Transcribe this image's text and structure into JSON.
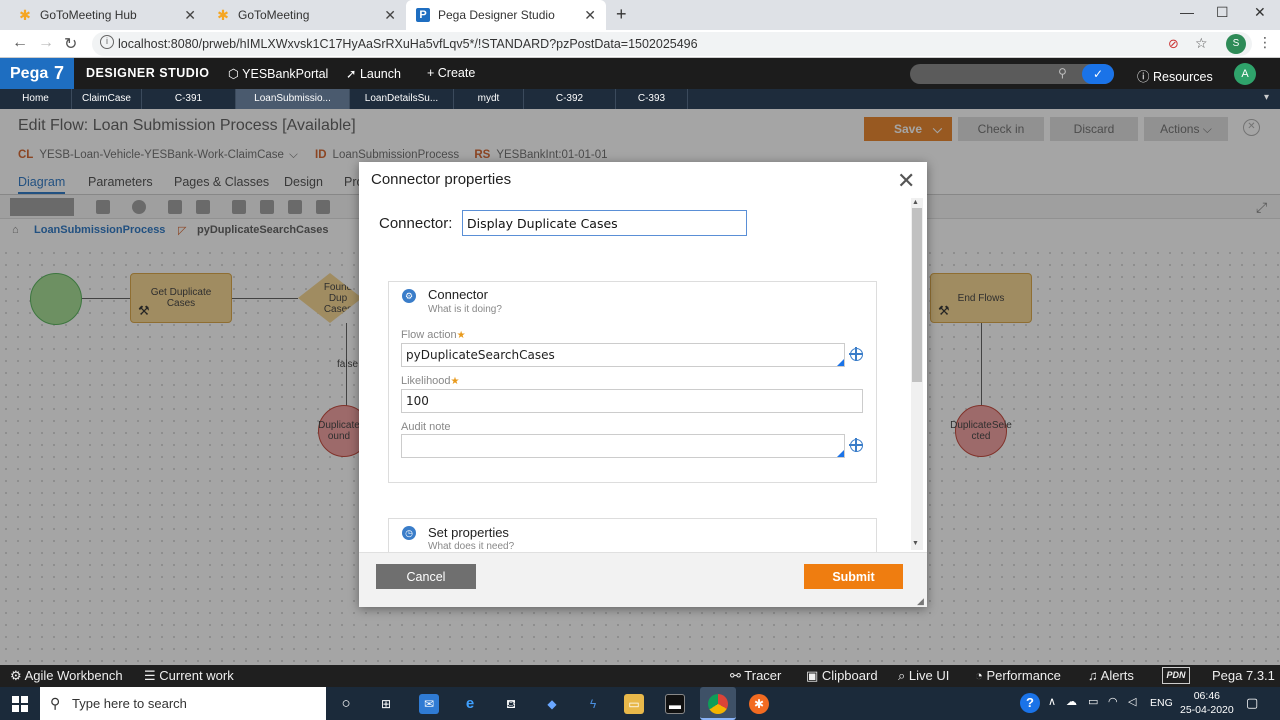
{
  "browser": {
    "tabs": [
      {
        "title": "GoToMeeting Hub"
      },
      {
        "title": "GoToMeeting"
      },
      {
        "title": "Pega Designer Studio"
      }
    ],
    "url": "localhost:8080/prweb/hIMLXWxvsk1C17HyAaSrRXuHa5vfLqv5*/!STANDARD?pzPostData=1502025496",
    "profile_initial": "S"
  },
  "pega_header": {
    "logo": "Pega",
    "version_badge": "7",
    "studio": "DESIGNER STUDIO",
    "app": "YESBankPortal",
    "launch": "Launch",
    "create": "Create",
    "resources": "Resources",
    "user_initial": "A"
  },
  "work_tabs": [
    "Home",
    "ClaimCase",
    "C-391",
    "LoanSubmissio...",
    "LoanDetailsSu...",
    "mydt",
    "C-392",
    "C-393"
  ],
  "rule_form": {
    "title": "Edit Flow: Loan Submission Process [Available]",
    "buttons": {
      "save": "Save",
      "checkin": "Check in",
      "discard": "Discard",
      "actions": "Actions"
    },
    "cl_label": "CL",
    "cl_value": "YESB-Loan-Vehicle-YESBank-Work-ClaimCase",
    "id_label": "ID",
    "id_value": "LoanSubmissionProcess",
    "rs_label": "RS",
    "rs_value": "YESBankInt:01-01-01",
    "tabs": [
      "Diagram",
      "Parameters",
      "Pages & Classes",
      "Design",
      "Pro"
    ],
    "breadcrumb": [
      "LoanSubmissionProcess",
      "pyDuplicateSearchCases"
    ]
  },
  "diagram": {
    "get_duplicate": "Get Duplicate Cases",
    "found_dup": "Found Dup Cases",
    "false_label": "false",
    "dup_found": "Duplicate ound",
    "end_flows": "End Flows",
    "dup_selected": "DuplicateSele cted"
  },
  "modal": {
    "title": "Connector properties",
    "connector_label": "Connector:",
    "connector_value": "Display Duplicate Cases",
    "section1": {
      "title": "Connector",
      "subtitle": "What is it doing?",
      "flow_action_label": "Flow action",
      "flow_action_value": "pyDuplicateSearchCases",
      "likelihood_label": "Likelihood",
      "likelihood_value": "100",
      "audit_label": "Audit note",
      "audit_value": ""
    },
    "section2": {
      "title": "Set properties",
      "subtitle": "What does it need?"
    },
    "cancel": "Cancel",
    "submit": "Submit"
  },
  "dev_bar": {
    "left": [
      "Agile Workbench",
      "Current work"
    ],
    "right": [
      "Tracer",
      "Clipboard",
      "Live UI",
      "Performance",
      "Alerts"
    ],
    "pdn": "PDN",
    "version": "Pega 7.3.1"
  },
  "taskbar": {
    "search_placeholder": "Type here to search",
    "lang": "ENG",
    "time": "06:46",
    "date": "25-04-2020"
  },
  "colors": {
    "pega_blue": "#1e6ec1",
    "submit_orange": "#ef7d10",
    "cancel_gray": "#6f6f6f"
  }
}
